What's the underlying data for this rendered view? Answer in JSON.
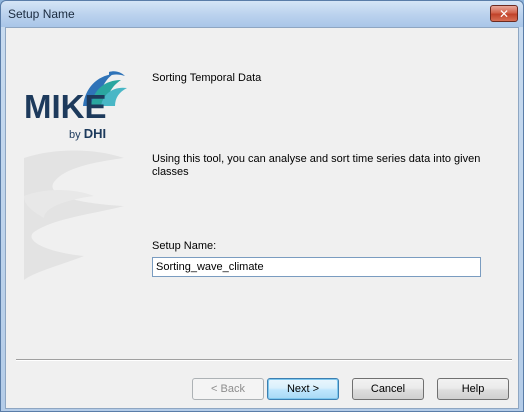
{
  "window": {
    "title": "Setup Name"
  },
  "logo": {
    "brand": "MIKE",
    "by": "by",
    "company": "DHI"
  },
  "content": {
    "heading": "Sorting Temporal Data",
    "description": "Using this tool, you can analyse and sort time series data into given classes",
    "setup_name_label": "Setup Name:",
    "setup_name_value": "Sorting_wave_climate"
  },
  "buttons": {
    "back": "< Back",
    "next": "Next >",
    "cancel": "Cancel",
    "help": "Help"
  },
  "colors": {
    "logo_text": "#1d3a5c",
    "logo_swirl_teal": "#2aa6a0",
    "logo_swirl_blue": "#2f73b8",
    "close_button": "#c1432a"
  }
}
